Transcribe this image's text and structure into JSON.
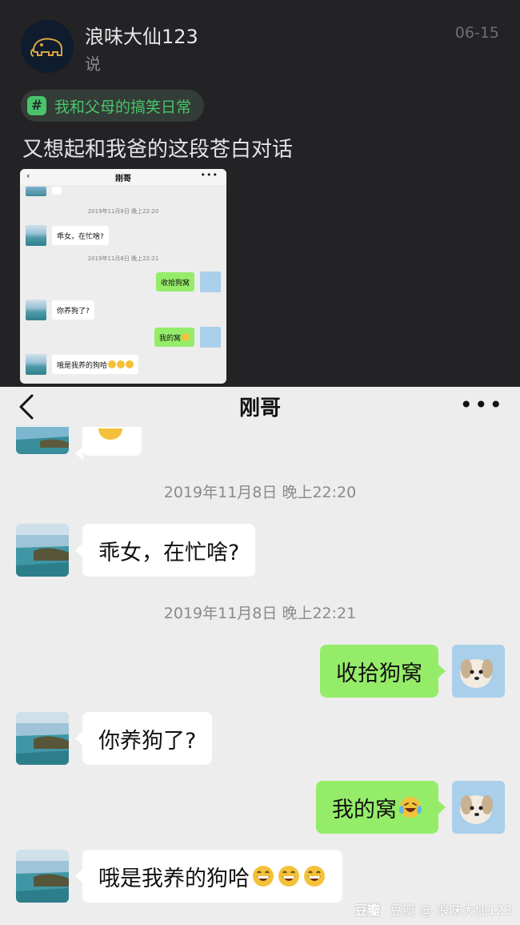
{
  "post": {
    "author": "浪味大仙123",
    "verb": "说",
    "date": "06-15",
    "topic": "我和父母的搞笑日常",
    "topic_icon": "#",
    "text": "又想起和我爸的这段苍白对话",
    "accent_color": "#49c46b"
  },
  "chat": {
    "title": "刚哥",
    "more_icon": "•••",
    "back_icon": "chevron-left-icon",
    "messages": [
      {
        "type": "timestamp",
        "text": "2019年11月8日 晚上22:20"
      },
      {
        "type": "incoming",
        "text": "乖女，在忙啥?"
      },
      {
        "type": "timestamp",
        "text": "2019年11月8日 晚上22:21"
      },
      {
        "type": "outgoing",
        "text": "收拾狗窝"
      },
      {
        "type": "incoming",
        "text": "你养狗了?"
      },
      {
        "type": "outgoing",
        "text": "我的窝",
        "emoji": "laughing-crying-emoji"
      },
      {
        "type": "incoming",
        "text": "哦是我养的狗哈",
        "emoji": "grinning-emoji x3"
      }
    ],
    "bubble_out_color": "#95ec69",
    "bubble_in_color": "#ffffff"
  },
  "watermark": {
    "logo": "豆瓣",
    "text": "豆瓣 @ 浪味大仙123"
  }
}
